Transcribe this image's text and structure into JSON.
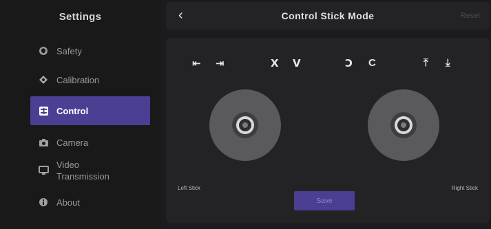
{
  "sidebar": {
    "title": "Settings",
    "items": [
      {
        "label": "Safety",
        "icon": "shield-icon"
      },
      {
        "label": "Calibration",
        "icon": "diamond-icon"
      },
      {
        "label": "Control",
        "icon": "controller-icon"
      },
      {
        "label": "Camera",
        "icon": "camera-icon"
      },
      {
        "label_line1": "Video",
        "label_line2": "Transmission",
        "icon": "monitor-icon"
      },
      {
        "label": "About",
        "icon": "info-icon"
      }
    ],
    "active": "Control"
  },
  "header": {
    "back": "‹",
    "title": "Control Stick Mode",
    "reset": "Reset"
  },
  "mode_icons": {
    "g1": "⇤",
    "g2": "⇥",
    "g3": "Ⅹ",
    "g4": "Ⅴ",
    "g5": "Ↄ",
    "g6": "C",
    "g7": "⤒",
    "g8": "⤓"
  },
  "sticks": {
    "left_label": "Left Stick",
    "right_label": "Right Stick"
  },
  "save_label": "Save",
  "colors": {
    "accent": "#4b3f93",
    "background": "#1b1b1d",
    "panel": "#232325"
  }
}
